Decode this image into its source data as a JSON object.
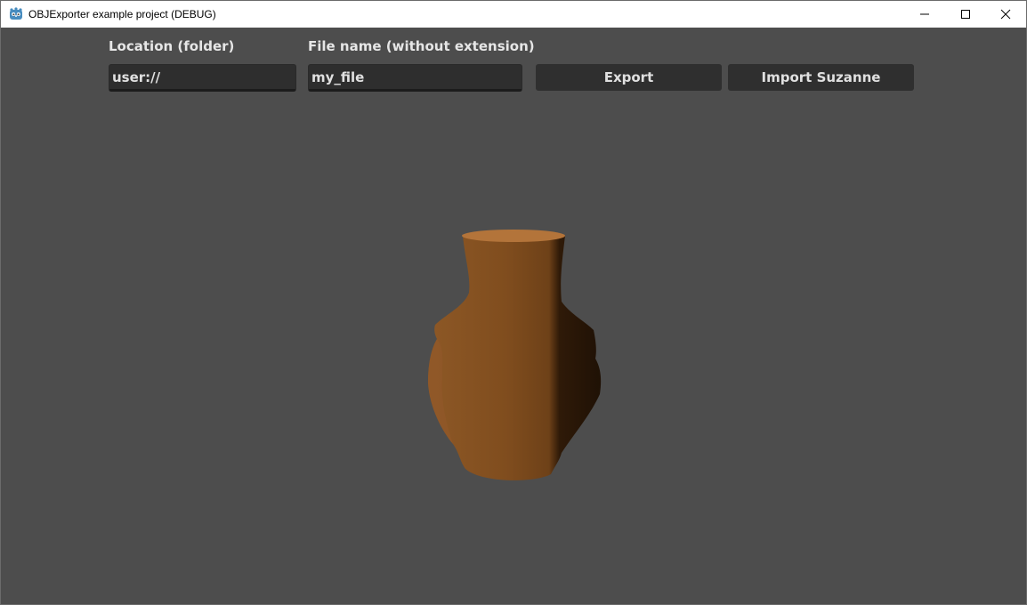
{
  "window": {
    "title": "OBJExporter example project (DEBUG)",
    "app_icon": "godot-icon",
    "controls": [
      "minimize-icon",
      "maximize-icon",
      "close-icon"
    ]
  },
  "form": {
    "location_label": "Location (folder)",
    "location_value": "user://",
    "filename_label": "File name (without extension)",
    "filename_value": "my_file",
    "export_label": "Export",
    "import_label": "Import Suzanne"
  },
  "scene": {
    "object": "vase",
    "colors": {
      "background": "#4d4d4d",
      "vase_body": "#8a5524",
      "vase_top": "#b5763c",
      "vase_shadow": "#2a1607"
    }
  }
}
